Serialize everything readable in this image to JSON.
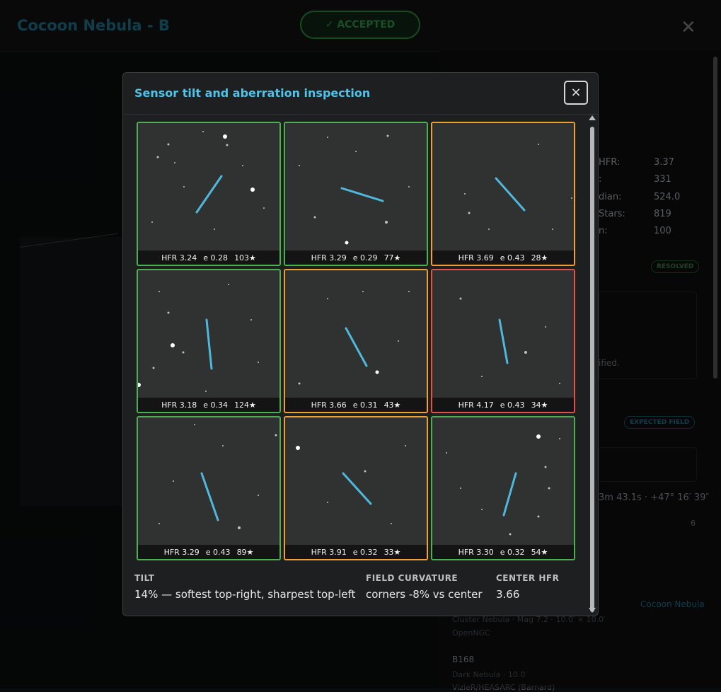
{
  "app": {
    "title": "Cocoon Nebula - B",
    "accepted_label": "✓ ACCEPTED",
    "close_glyph": "✕"
  },
  "panel": {
    "stats": [
      {
        "label": "HFR:",
        "value": "3.37"
      },
      {
        "label": ":",
        "value": "331"
      },
      {
        "label": "dian:",
        "value": "524.0"
      },
      {
        "label": "Stars:",
        "value": "819"
      },
      {
        "label": "n:",
        "value": "100"
      }
    ],
    "resolved_badge": "RESOLVED",
    "identified_fragment": "ified.",
    "expected_field_badge": "EXPECTED FIELD",
    "coord_fragment": "3m 43.1s · +47° 16′ 39″",
    "count_fragment": "6",
    "link_cocoon": "Cocoon Nebula",
    "cluster_fragment": "Cluster Nebula · Mag 7.2 · 10.0′ × 10.0′",
    "openngc": "OpenNGC",
    "b168_title": "B168",
    "b168_sub": "Dark Nebula · 10.0′",
    "b168_extra": "VizieR/HEASARC (Barnard)"
  },
  "modal": {
    "title": "Sensor tilt and aberration inspection",
    "close_glyph": "×",
    "tiles": [
      {
        "hfr": "HFR 3.24",
        "ecc": "e 0.28",
        "stars": "103★",
        "status": "good"
      },
      {
        "hfr": "HFR 3.29",
        "ecc": "e 0.29",
        "stars": "77★",
        "status": "good"
      },
      {
        "hfr": "HFR 3.69",
        "ecc": "e 0.43",
        "stars": "28★",
        "status": "warn"
      },
      {
        "hfr": "HFR 3.18",
        "ecc": "e 0.34",
        "stars": "124★",
        "status": "good"
      },
      {
        "hfr": "HFR 3.66",
        "ecc": "e 0.31",
        "stars": "43★",
        "status": "warn"
      },
      {
        "hfr": "HFR 4.17",
        "ecc": "e 0.43",
        "stars": "34★",
        "status": "bad"
      },
      {
        "hfr": "HFR 3.29",
        "ecc": "e 0.43",
        "stars": "89★",
        "status": "good"
      },
      {
        "hfr": "HFR 3.91",
        "ecc": "e 0.32",
        "stars": "33★",
        "status": "warn"
      },
      {
        "hfr": "HFR 3.30",
        "ecc": "e 0.32",
        "stars": "54★",
        "status": "good"
      }
    ],
    "tilt_label": "TILT",
    "tilt_value": "14% — softest top-right, sharpest top-left",
    "curvature_label": "FIELD CURVATURE",
    "curvature_value": "corners -8% vs center",
    "center_label": "CENTER HFR",
    "center_value": "3.66"
  },
  "colors": {
    "good": "#4caf50",
    "warn": "#f0a030",
    "bad": "#e0524a",
    "accent": "#4fc3e8",
    "vector": "#4fb8dc"
  }
}
